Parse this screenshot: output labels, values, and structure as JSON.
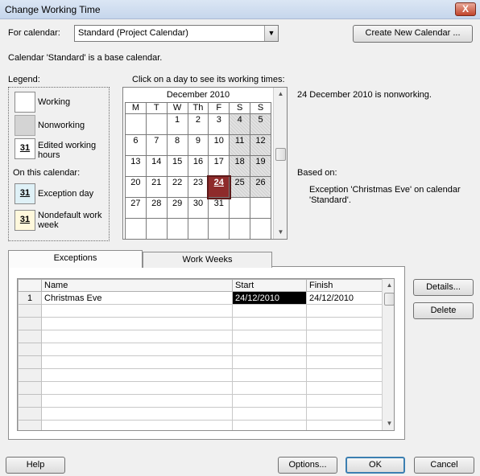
{
  "window": {
    "title": "Change Working Time",
    "close_glyph": "X"
  },
  "header": {
    "for_calendar_label": "For calendar:",
    "calendar_value": "Standard (Project Calendar)",
    "create_new_calendar": "Create New Calendar ...",
    "base_calendar_note": "Calendar 'Standard' is a base calendar."
  },
  "legend": {
    "title": "Legend:",
    "working": "Working",
    "nonworking": "Nonworking",
    "edited_hours": "Edited working hours",
    "on_this_calendar": "On this calendar:",
    "exception_day": "Exception day",
    "nondefault_week": "Nondefault work week",
    "swatch_number": "31"
  },
  "calendar": {
    "instruction": "Click on a day to see its working times:",
    "month": "December 2010",
    "weekdays": [
      "M",
      "T",
      "W",
      "Th",
      "F",
      "S",
      "S"
    ],
    "weeks": [
      [
        "",
        "",
        "1",
        "2",
        "3",
        "4",
        "5"
      ],
      [
        "6",
        "7",
        "8",
        "9",
        "10",
        "11",
        "12"
      ],
      [
        "13",
        "14",
        "15",
        "16",
        "17",
        "18",
        "19"
      ],
      [
        "20",
        "21",
        "22",
        "23",
        "24",
        "25",
        "26"
      ],
      [
        "27",
        "28",
        "29",
        "30",
        "31",
        "",
        ""
      ],
      [
        "",
        "",
        "",
        "",
        "",
        "",
        ""
      ]
    ],
    "selected_day": "24"
  },
  "info": {
    "status": "24 December 2010 is nonworking.",
    "based_on_label": "Based on:",
    "based_on_text": "Exception 'Christmas Eve' on calendar 'Standard'."
  },
  "tabs": [
    "Exceptions",
    "Work Weeks"
  ],
  "exceptions": {
    "columns": [
      "Name",
      "Start",
      "Finish"
    ],
    "rows": [
      {
        "num": "1",
        "name": "Christmas Eve",
        "start": "24/12/2010",
        "finish": "24/12/2010"
      }
    ]
  },
  "side_buttons": {
    "details": "Details...",
    "delete": "Delete"
  },
  "footer": {
    "help": "Help",
    "options": "Options...",
    "ok": "OK",
    "cancel": "Cancel"
  },
  "colors": {
    "selected_day": "#8e2b2b",
    "exception_swatch": "#dff1f7",
    "nondefault_swatch": "#fff8dc"
  }
}
